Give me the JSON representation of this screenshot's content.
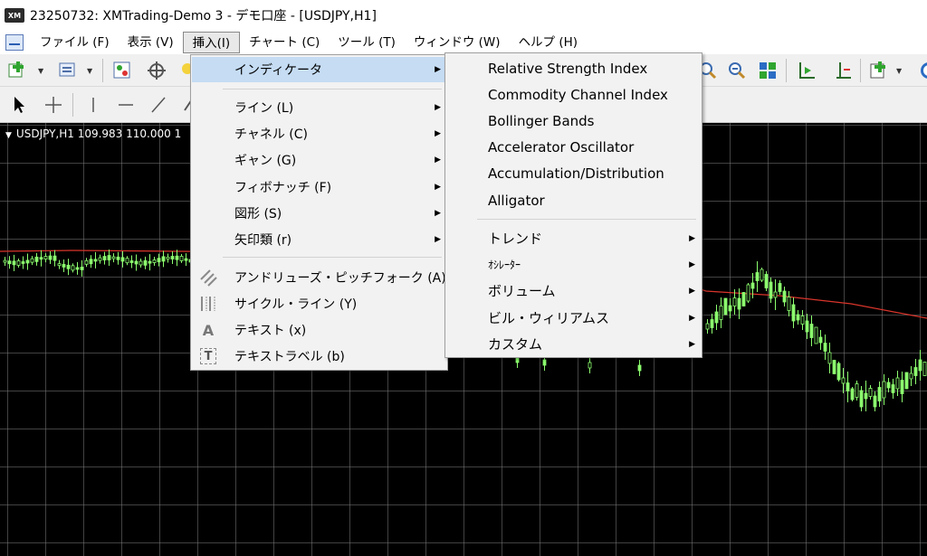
{
  "app": {
    "logo": "XM",
    "title": "23250732: XMTrading-Demo 3 - デモ口座 - [USDJPY,H1]"
  },
  "menubar": {
    "items": [
      {
        "label": "ファイル (F)"
      },
      {
        "label": "表示 (V)"
      },
      {
        "label": "挿入(I)"
      },
      {
        "label": "チャート (C)"
      },
      {
        "label": "ツール (T)"
      },
      {
        "label": "ウィンドウ (W)"
      },
      {
        "label": "ヘルプ (H)"
      }
    ]
  },
  "chart": {
    "label": "USDJPY,H1  109.983 110.000 1"
  },
  "insert_menu": {
    "items": [
      {
        "label": "インディケータ"
      },
      {
        "label": "ライン (L)"
      },
      {
        "label": "チャネル (C)"
      },
      {
        "label": "ギャン (G)"
      },
      {
        "label": "フィボナッチ (F)"
      },
      {
        "label": "図形 (S)"
      },
      {
        "label": "矢印類 (r)"
      },
      {
        "label": "アンドリューズ・ピッチフォーク (A)"
      },
      {
        "label": "サイクル・ライン (Y)"
      },
      {
        "label": "テキスト (x)"
      },
      {
        "label": "テキストラベル (b)"
      }
    ],
    "text_icon_glyph": "A",
    "label_icon_glyph": "T"
  },
  "indicators_submenu": {
    "items": [
      {
        "label": "Relative Strength Index"
      },
      {
        "label": "Commodity Channel Index"
      },
      {
        "label": "Bollinger Bands"
      },
      {
        "label": "Accelerator Oscillator"
      },
      {
        "label": "Accumulation/Distribution"
      },
      {
        "label": "Alligator"
      },
      {
        "label": "トレンド"
      },
      {
        "label": "ｵｼﾚｰﾀｰ"
      },
      {
        "label": "ボリューム"
      },
      {
        "label": "ビル・ウィリアムス"
      },
      {
        "label": "カスタム"
      }
    ]
  },
  "colors": {
    "candle": "#8cff6e",
    "ma_line": "#d9352b",
    "highlight": "#c5dcf3"
  }
}
